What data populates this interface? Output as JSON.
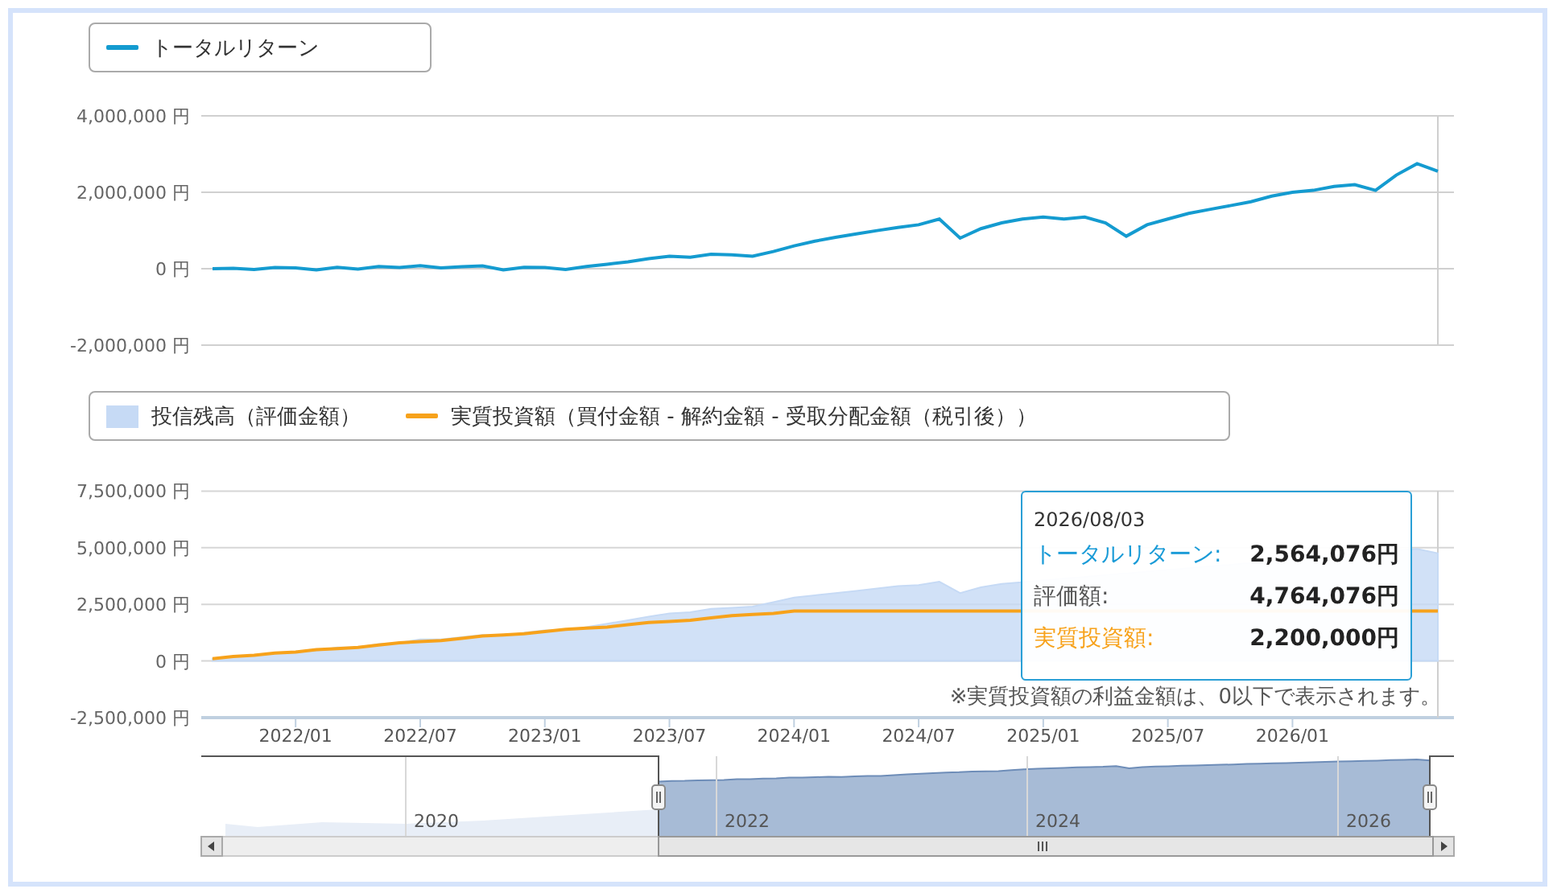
{
  "return_chart": {
    "chart_data": {
      "type": "line",
      "grid": true,
      "ylim": [
        -2000000,
        4000000
      ],
      "yticks": [
        {
          "value": 4000000,
          "label": "4,000,000 円"
        },
        {
          "value": 2000000,
          "label": "2,000,000 円"
        },
        {
          "value": 0,
          "label": "0 円"
        },
        {
          "value": -2000000,
          "label": "-2,000,000 円"
        }
      ],
      "series": [
        {
          "name": "トータルリターン",
          "color": "#149bd0",
          "values": [
            0,
            10000,
            -20000,
            30000,
            20000,
            -30000,
            40000,
            -10000,
            60000,
            30000,
            80000,
            20000,
            50000,
            70000,
            -30000,
            40000,
            30000,
            -20000,
            60000,
            120000,
            180000,
            260000,
            330000,
            300000,
            380000,
            360000,
            330000,
            450000,
            600000,
            720000,
            820000,
            910000,
            1000000,
            1080000,
            1150000,
            1300000,
            800000,
            1050000,
            1200000,
            1300000,
            1350000,
            1300000,
            1350000,
            1200000,
            850000,
            1150000,
            1300000,
            1450000,
            1550000,
            1650000,
            1750000,
            1900000,
            2000000,
            2050000,
            2150000,
            2200000,
            2050000,
            2450000,
            2750000,
            2550000
          ]
        }
      ]
    }
  },
  "balance_chart": {
    "chart_data": {
      "type": "area",
      "grid": true,
      "ylim": [
        -2500000,
        7500000
      ],
      "categories": [
        null,
        null,
        null,
        null,
        "2022/01",
        null,
        null,
        null,
        null,
        null,
        "2022/07",
        null,
        null,
        null,
        null,
        null,
        "2023/01",
        null,
        null,
        null,
        null,
        null,
        "2023/07",
        null,
        null,
        null,
        null,
        null,
        "2024/01",
        null,
        null,
        null,
        null,
        null,
        "2024/07",
        null,
        null,
        null,
        null,
        null,
        "2025/01",
        null,
        null,
        null,
        null,
        null,
        "2025/07",
        null,
        null,
        null,
        null,
        null,
        "2026/01",
        null,
        null,
        null,
        null,
        null,
        null,
        null
      ],
      "yticks": [
        {
          "value": 7500000,
          "label": "7,500,000 円"
        },
        {
          "value": 5000000,
          "label": "5,000,000 円"
        },
        {
          "value": 2500000,
          "label": "2,500,000 円"
        },
        {
          "value": 0,
          "label": "0 円"
        },
        {
          "value": -2500000,
          "label": "-2,500,000 円"
        }
      ],
      "series": [
        {
          "name": "投信残高（評価金額）",
          "type": "area",
          "color": "#c6daf5",
          "values": [
            100000,
            200000,
            250000,
            350000,
            400000,
            450000,
            600000,
            600000,
            750000,
            800000,
            950000,
            950000,
            1050000,
            1150000,
            1100000,
            1250000,
            1350000,
            1350000,
            1500000,
            1650000,
            1800000,
            1950000,
            2100000,
            2150000,
            2300000,
            2350000,
            2400000,
            2600000,
            2800000,
            2900000,
            3000000,
            3100000,
            3200000,
            3300000,
            3350000,
            3500000,
            3000000,
            3250000,
            3400000,
            null,
            null,
            null,
            null,
            null,
            null,
            null,
            null,
            null,
            null,
            null,
            null,
            null,
            null,
            null,
            null,
            null,
            null,
            null,
            4950000,
            4750000
          ]
        },
        {
          "name": "実質投資額（買付金額 - 解約金額 - 受取分配金額（税引後））",
          "type": "line",
          "color": "#f7a21b",
          "values": [
            100000,
            200000,
            250000,
            350000,
            400000,
            500000,
            550000,
            600000,
            700000,
            800000,
            850000,
            900000,
            1000000,
            1100000,
            1150000,
            1200000,
            1300000,
            1400000,
            1450000,
            1500000,
            1600000,
            1700000,
            1750000,
            1800000,
            1900000,
            2000000,
            2050000,
            2100000,
            2200000,
            2200000,
            2200000,
            2200000,
            2200000,
            2200000,
            2200000,
            2200000,
            2200000,
            2200000,
            2200000,
            2200000,
            null,
            null,
            null,
            null,
            null,
            null,
            null,
            null,
            null,
            null,
            null,
            null,
            null,
            null,
            null,
            null,
            null,
            null,
            2200000,
            2200000
          ]
        }
      ]
    },
    "note": "※実質投資額の利益金額は、0以下で表示されます。",
    "tooltip": {
      "date": "2026/08/03",
      "rows": [
        {
          "label": "トータルリターン:",
          "value": "2,564,076円",
          "color": "#1a9bd7"
        },
        {
          "label": "評価額:",
          "value": "4,764,076円",
          "color": "#555555"
        },
        {
          "label": "実質投資額:",
          "value": "2,200,000円",
          "color": "#f7a21b"
        }
      ]
    }
  },
  "navigator": {
    "labels": [
      "2020",
      "2022",
      "2024",
      "2026"
    ]
  }
}
